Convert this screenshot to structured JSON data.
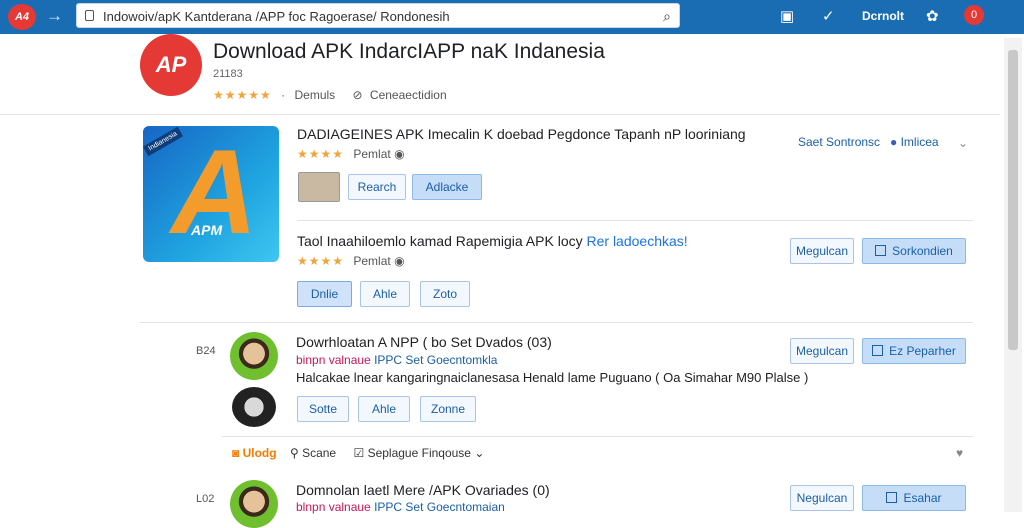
{
  "browser": {
    "logo_text": "A4",
    "url": "Indowoiv/apK  Kantderana /APP foc Ragoerase/ Rondonesih",
    "account_label": "Dcrnolt",
    "power_label": "0"
  },
  "header": {
    "logo_text": "AP",
    "title": "Download APK IndarcIAPP naK Indanesia",
    "count": "21183",
    "rating_stars": "★★★★★",
    "rating_sep": "·",
    "meta_1": "Demuls",
    "meta_2": "Ceneaectidion"
  },
  "card1": {
    "image_label": "APM",
    "image_badge": "Indianesia",
    "title": "DADIAGEINES APK Imecalin K doebad Pegdonce Tapanh nP looriniang",
    "stars": "★★★★",
    "meta": "Pemlat",
    "btn_1": "Rearch",
    "btn_2": "Adlacke",
    "side_link": "Saet Sontronsc",
    "side_link_2": "Imlicea"
  },
  "card2": {
    "title_main": "Taol Inaahiloemlo kamad Rapemigia APK locy",
    "title_link": "Rer ladoechkas!",
    "stars": "★★★★",
    "meta": "Pemlat",
    "btn_1": "Dnlie",
    "btn_2": "Ahle",
    "btn_3": "Zoto",
    "right_btn_1": "Megulcan",
    "right_btn_2": "Sorkondien"
  },
  "card3": {
    "num": "B24",
    "title": "Dowrhloatan A NPP  ( bo Set  Dvados  (03)",
    "sub_red": "binpn valnaue",
    "sub_blue": "IPPC Set Goecntomkla",
    "desc": "Halcakae lnear kangaringnaiclanesasa  Henald lame Puguano  ( Oa Simahar M90 Plalse )",
    "btn_1": "Sotte",
    "btn_2": "Ahle",
    "btn_3": "Zonne",
    "right_btn_1": "Megulcan",
    "right_btn_2": "Ez Peparher"
  },
  "actions": {
    "item_1": "Ulodg",
    "item_2": "Scane",
    "item_3": "Seplague Finqouse"
  },
  "card4": {
    "num": "L02",
    "title": "Domnolan laetl  Mere /APK Ovariades  (0)",
    "sub_red": "blnpn valnaue",
    "sub_blue": "IPPC Set Goecntomaian",
    "right_btn_1": "Negulcan",
    "right_btn_2": "Esahar"
  }
}
